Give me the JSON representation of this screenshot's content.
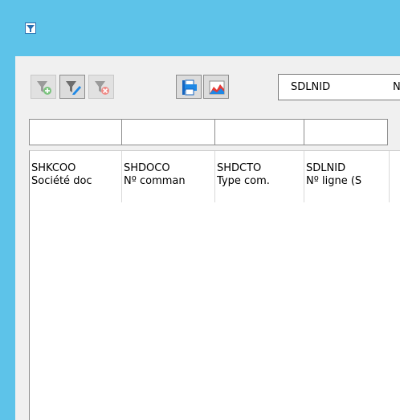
{
  "window": {
    "icon": "app-filter-icon"
  },
  "toolbar": {
    "buttons": [
      {
        "name": "add-filter-button",
        "icon": "funnel-plus-icon",
        "enabled": false
      },
      {
        "name": "edit-filter-button",
        "icon": "funnel-pencil-icon",
        "enabled": true
      },
      {
        "name": "remove-filter-button",
        "icon": "funnel-delete-icon",
        "enabled": false
      },
      {
        "name": "print-button",
        "icon": "printer-icon",
        "enabled": true
      },
      {
        "name": "chart-button",
        "icon": "chart-icon",
        "enabled": true
      }
    ],
    "column_selector": {
      "value": "SDLNID",
      "second_value": "N"
    }
  },
  "grid": {
    "columns": [
      {
        "code": "SHKCOO",
        "label": "Société doc"
      },
      {
        "code": "SHDOCO",
        "label": "Nº comman"
      },
      {
        "code": "SHDCTO",
        "label": "Type com."
      },
      {
        "code": "SDLNID",
        "label": "Nº ligne (S"
      }
    ],
    "rows": []
  },
  "colors": {
    "titlebar": "#5dc3e9",
    "accent_blue": "#1e88e5",
    "green": "#43a047",
    "red": "#e53935"
  }
}
